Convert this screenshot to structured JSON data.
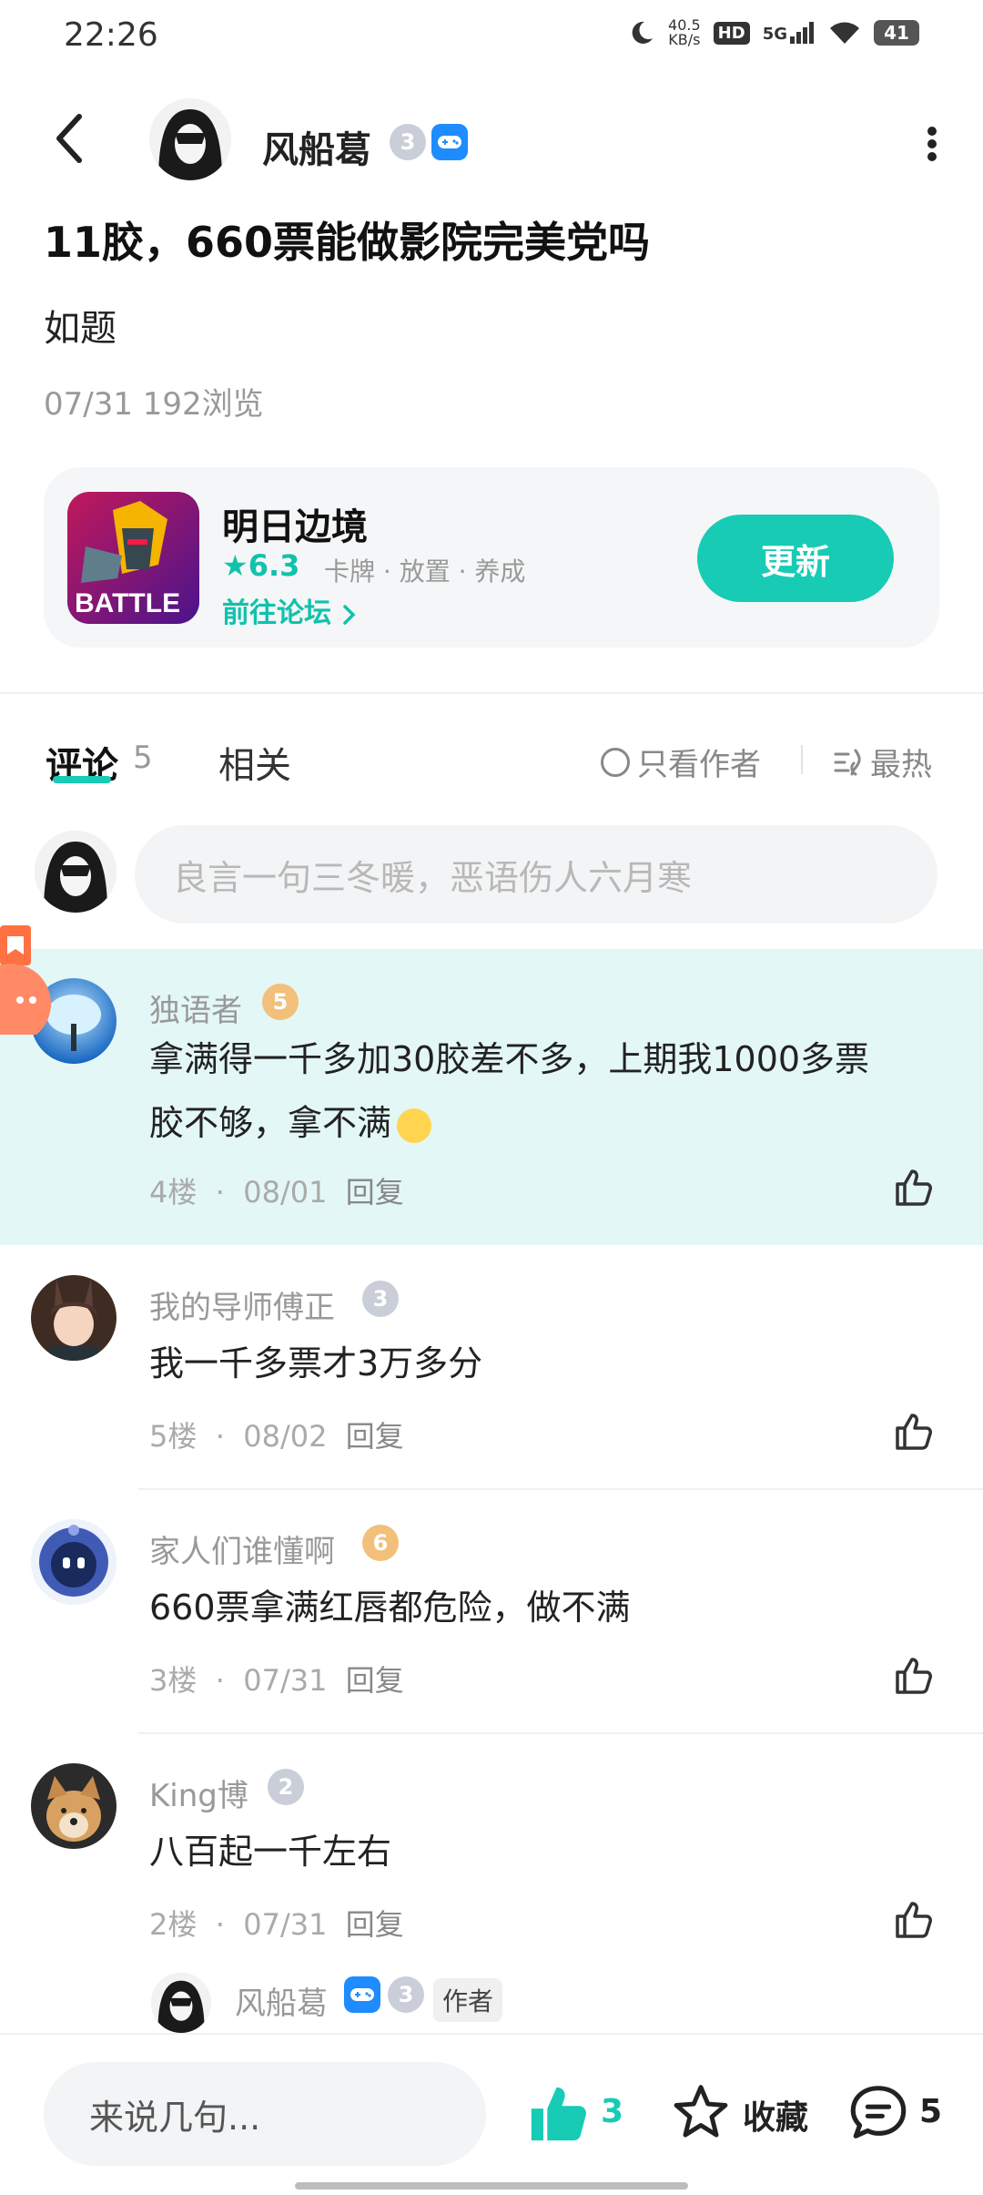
{
  "status_bar": {
    "time": "22:26",
    "net_speed_value": "40.5",
    "net_speed_unit": "KB/s",
    "hd": "HD",
    "signal": "5G",
    "battery": "41"
  },
  "post": {
    "author": "风船葛",
    "author_level": "3",
    "title": "11胶，660票能做影院完美党吗",
    "body": "如题",
    "meta": "07/31  192浏览"
  },
  "game_card": {
    "name": "明日边境",
    "rating": "6.3",
    "tags": "卡牌  ·  放置  ·  养成",
    "forum_link": "前往论坛",
    "update_button": "更新"
  },
  "tabs": {
    "comment": "评论",
    "comment_count": "5",
    "related": "相关",
    "only_author": "只看作者",
    "sort": "最热"
  },
  "comment_input": {
    "placeholder": "良言一句三冬暖，恶语伤人六月寒"
  },
  "comments": [
    {
      "name": "独语者",
      "level": "5",
      "text_line1": "拿满得一千多加30胶差不多，上期我1000多票",
      "text_line2": "胶不够，拿不满",
      "floor": "4楼",
      "date": "08/01",
      "reply": "回复"
    },
    {
      "name": "我的导师傅正",
      "level": "3",
      "text": "我一千多票才3万多分",
      "floor": "5楼",
      "date": "08/02",
      "reply": "回复"
    },
    {
      "name": "家人们谁懂啊",
      "level": "6",
      "text": "660票拿满红唇都危险，做不满",
      "floor": "3楼",
      "date": "07/31",
      "reply": "回复"
    },
    {
      "name": "King博",
      "level": "2",
      "text": "八百起一千左右",
      "floor": "2楼",
      "date": "07/31",
      "reply": "回复"
    }
  ],
  "sub_reply": {
    "name": "风船葛",
    "level": "3",
    "tag": "作者"
  },
  "bottom_bar": {
    "input_label": "来说几句...",
    "like_count": "3",
    "favorite": "收藏",
    "comment_count": "5"
  },
  "colors": {
    "accent": "#18cbb4",
    "highlight_bg": "#e3f7f6",
    "badge_blue": "#1e8cff"
  }
}
